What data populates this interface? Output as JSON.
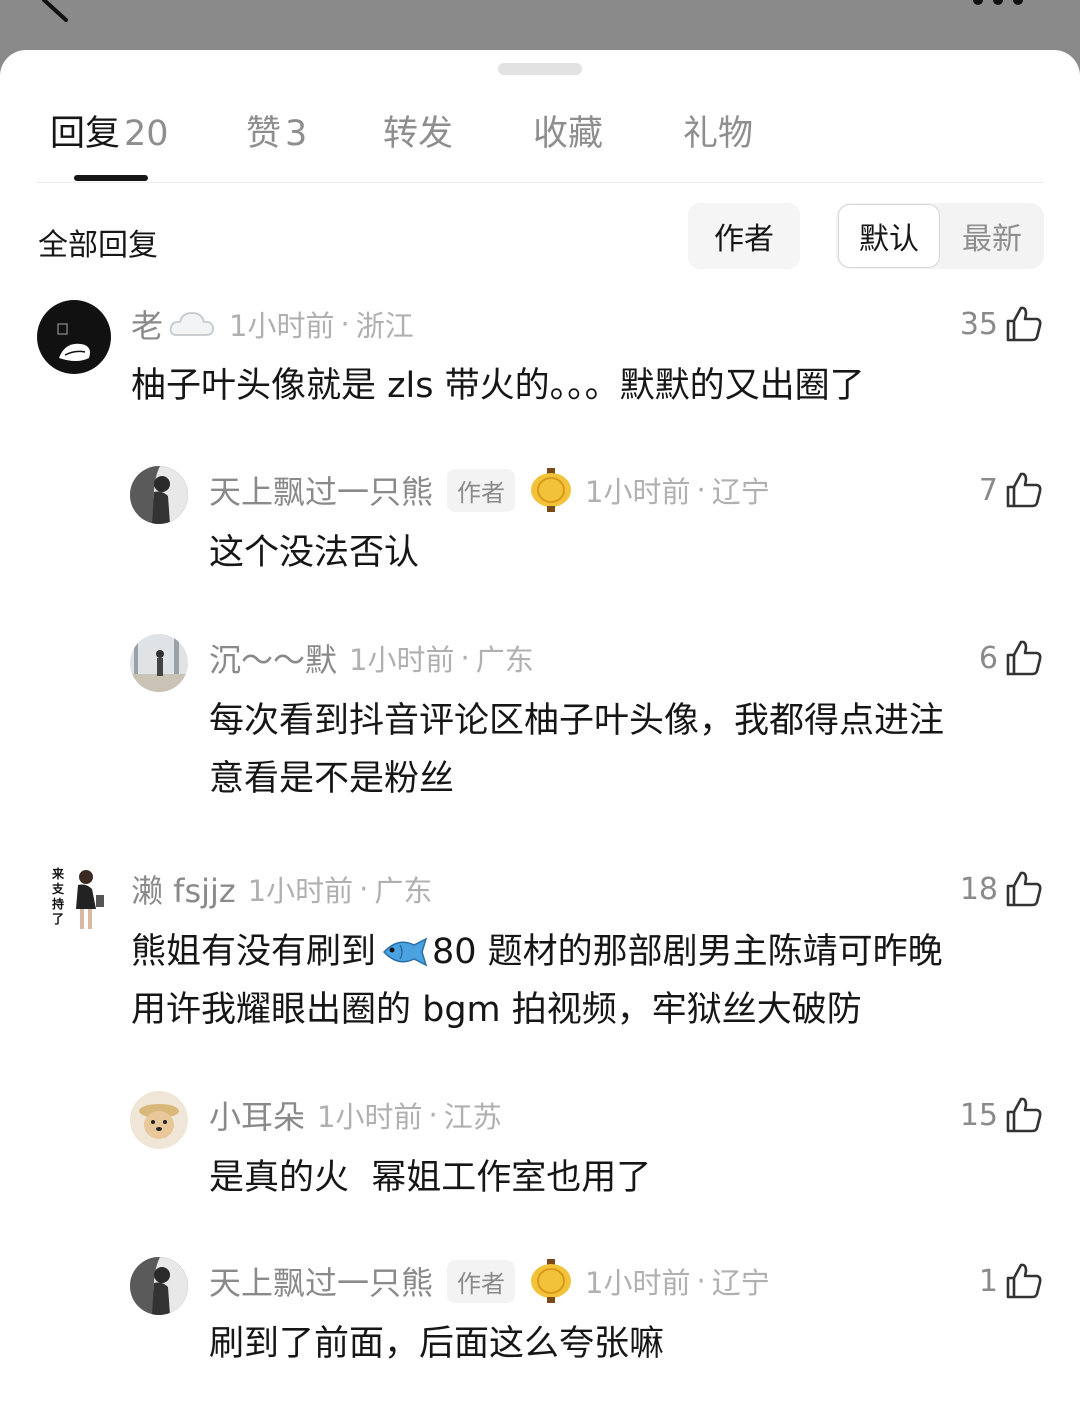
{
  "tabs": [
    {
      "label": "回复",
      "count": "20"
    },
    {
      "label": "赞",
      "count": "3"
    },
    {
      "label": "转发",
      "count": ""
    },
    {
      "label": "收藏",
      "count": ""
    },
    {
      "label": "礼物",
      "count": ""
    }
  ],
  "filter": {
    "all_label": "全部回复",
    "author_label": "作者",
    "sort_default": "默认",
    "sort_latest": "最新"
  },
  "comments": [
    {
      "user": "老",
      "time": "1小时前",
      "region": "浙江",
      "likes": "35",
      "text": "柚子叶头像就是 zls 带火的。。。默默的又出圈了"
    },
    {
      "user": "天上飘过一只熊",
      "author_tag": "作者",
      "time": "1小时前",
      "region": "辽宁",
      "likes": "7",
      "text": "这个没法否认"
    },
    {
      "user": "沉～～默",
      "time": "1小时前",
      "region": "广东",
      "likes": "6",
      "text_line1": "每次看到抖音评论区柚子叶头像，我都得点进注",
      "text_line2": "意看是不是粉丝"
    },
    {
      "user": "濑 fsjjz",
      "avatar_text": "来支持了",
      "time": "1小时前",
      "region": "广东",
      "likes": "18",
      "text_line1_a": "熊姐有没有刷到",
      "text_line1_b": "80 题材的那部剧男主陈靖可昨晚",
      "text_line2": "用许我耀眼出圈的 bgm 拍视频，牢狱丝大破防"
    },
    {
      "user": "小耳朵",
      "time": "1小时前",
      "region": "江苏",
      "likes": "15",
      "text": "是真的火  幂姐工作室也用了"
    },
    {
      "user": "天上飘过一只熊",
      "author_tag": "作者",
      "time": "1小时前",
      "region": "辽宁",
      "likes": "1",
      "text": "刷到了前面，后面这么夸张嘛"
    }
  ],
  "colors": {
    "accent": "#161616",
    "muted": "#8a8a8a",
    "meta": "#b0b0b0",
    "background": "#ffffff"
  }
}
